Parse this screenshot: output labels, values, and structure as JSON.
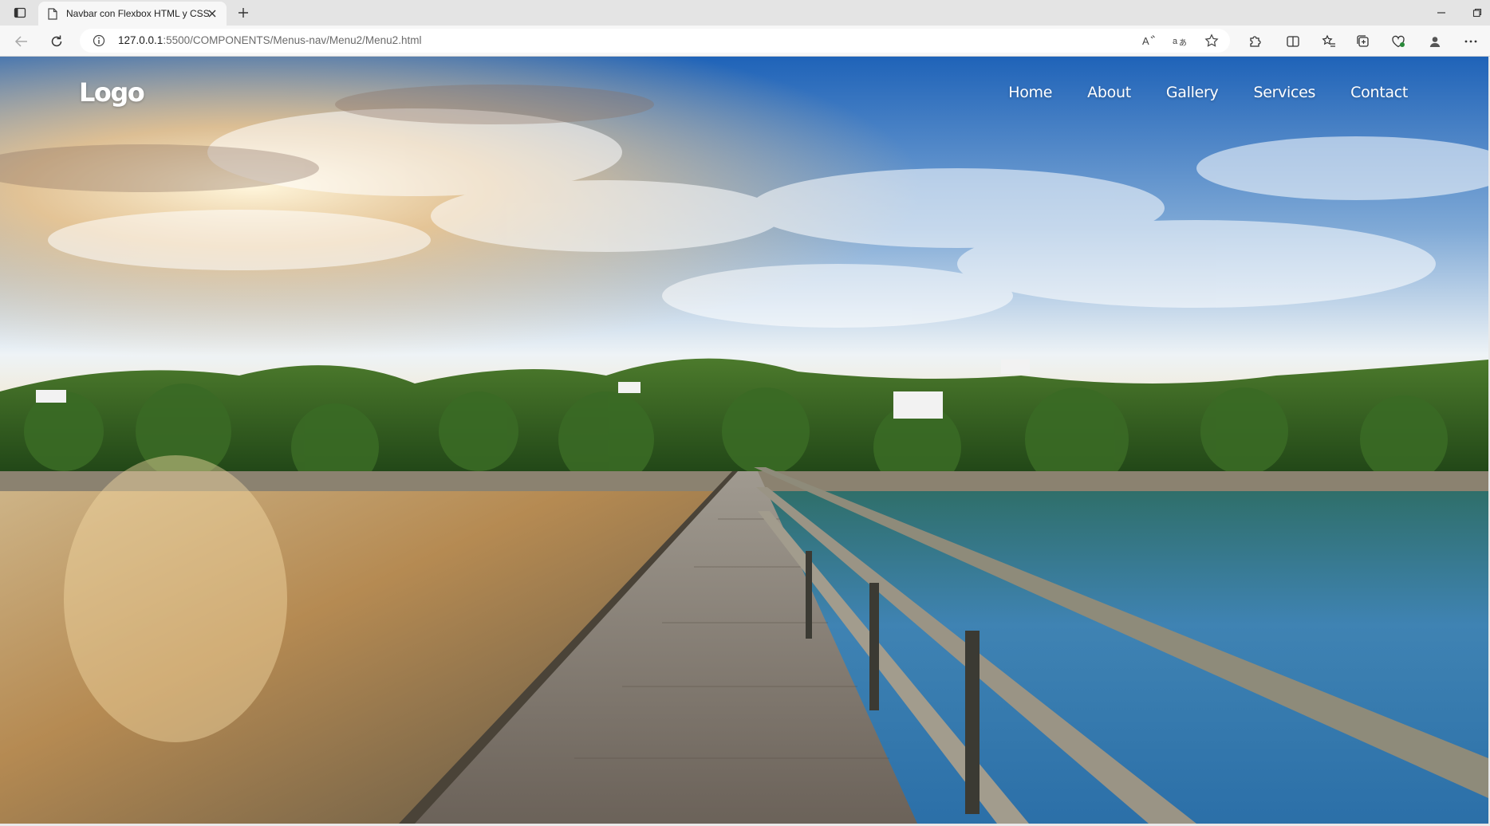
{
  "browser": {
    "tab": {
      "title": "Navbar con Flexbox HTML y CSS"
    },
    "address": {
      "host": "127.0.0.1",
      "path": ":5500/COMPONENTS/Menus-nav/Menu2/Menu2.html"
    }
  },
  "site": {
    "logo": "Logo",
    "nav": [
      {
        "label": "Home"
      },
      {
        "label": "About"
      },
      {
        "label": "Gallery"
      },
      {
        "label": "Services"
      },
      {
        "label": "Contact"
      }
    ]
  },
  "hero": {
    "sky_top": "#1f63b8",
    "sunset_glow": "#f6c98b",
    "foliage": "#2f5f22",
    "water_left": "#b58a52",
    "water_right": "#3f83b3",
    "boardwalk": "#8a8276"
  }
}
